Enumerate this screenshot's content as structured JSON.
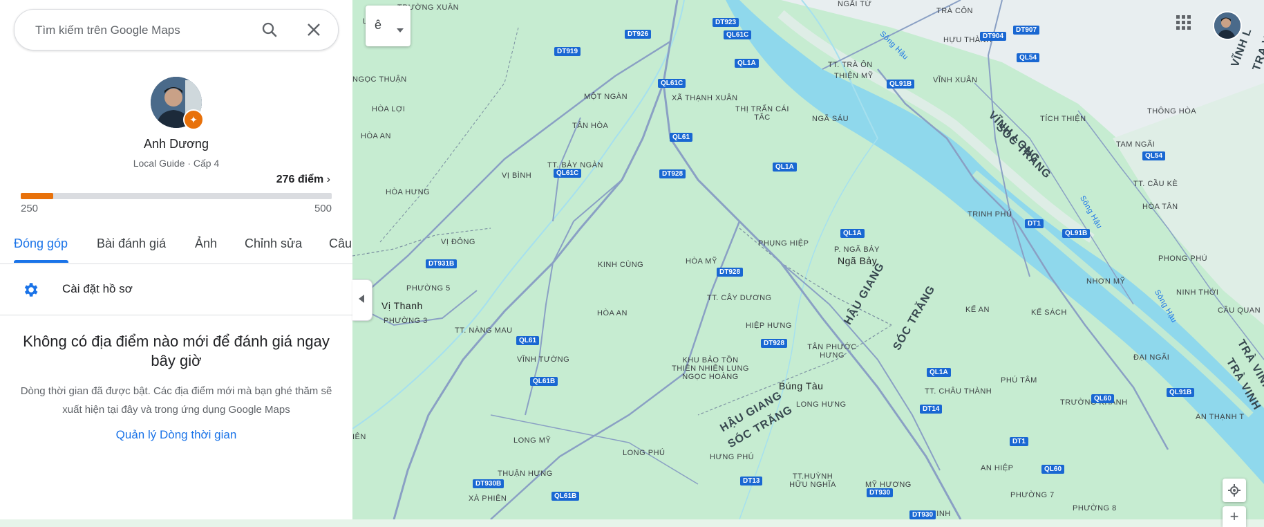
{
  "search": {
    "placeholder": "Tìm kiếm trên Google Maps"
  },
  "profile": {
    "name": "Anh Dương",
    "level": "Local Guide · Cấp 4",
    "points_label": "276 điểm",
    "progress": {
      "min": "250",
      "max": "500",
      "fraction": 0.104
    }
  },
  "tabs": [
    {
      "label": "Đóng góp",
      "active": true
    },
    {
      "label": "Bài đánh giá"
    },
    {
      "label": "Ảnh"
    },
    {
      "label": "Chỉnh sửa"
    },
    {
      "label": "Câu"
    }
  ],
  "settings": {
    "label": "Cài đặt hồ sơ"
  },
  "empty_state": {
    "title": "Không có địa điểm nào mới để đánh giá ngay bây giờ",
    "description": "Dòng thời gian đã được bật. Các địa điểm mới mà bạn ghé thăm sẽ xuất hiện tại đây và trong ứng dụng Google Maps",
    "link": "Quản lý Dòng thời gian"
  },
  "map": {
    "layers_control_label": "ê",
    "place_labels": {
      "truong_xuan": "TRƯỜNG XUÂN",
      "ngai_tu": "NGÃI TỨ",
      "tra_con": "TRÀ CÔN",
      "huu_thanh": "HỰU THÀNH",
      "ngoc_thuan": "NGỌC THUẬN",
      "mot_ngan": "MỘT NGÀN",
      "xa_thanh_xuan": "XÃ THẠNH XUÂN",
      "hoa_loi": "HÒA LỢI",
      "tan_hoa": "TÂN HÒA",
      "thi_tran_cai_tac": "THỊ TRẤN CÁI TẮC",
      "nga_sau": "NGÃ SÁU",
      "tt_tra_on": "TT. TRÀ ÔN",
      "thien_my": "THIỆN MỸ",
      "vinh_xuan": "VĨNH XUÂN",
      "hoa_an_1": "HÒA AN",
      "tich_thien": "TÍCH THIỆN",
      "thong_hoa": "THÔNG HÒA",
      "tam_ngai": "TAM NGÃI",
      "vi_binh": "VỊ BÌNH",
      "tt_bay_ngan": "TT. BẢY NGÀN",
      "hoa_hung": "HÒA HƯNG",
      "tt_cau_ke": "TT. CẦU KÈ",
      "trinh_phu": "TRINH PHÚ",
      "hoa_tan": "HÒA TÂN",
      "vi_dong": "VỊ ĐÔNG",
      "phung_hiep": "PHỤNG HIỆP",
      "p_nga_bay": "P. NGÃ BẢY",
      "nga_bay": "Ngã Bảy",
      "kinh_cung": "KINH CÙNG",
      "hoa_my": "HÒA MỸ",
      "phong_phu": "PHONG PHÚ",
      "phuong_5": "PHƯỜNG 5",
      "vi_thanh": "Vị Thanh",
      "phuong_3": "PHƯỜNG 3",
      "nhon_my": "NHƠN MỸ",
      "ninh_thoi": "NINH THỚI",
      "tt_cay_duong": "TT. CÂY DƯƠNG",
      "hoa_an_2": "HÒA AN",
      "ke_an": "KẾ AN",
      "ke_sach": "KẾ SÁCH",
      "cau_quan": "CẦU QUAN",
      "tt_nang_mau": "TT. NÀNG MAU",
      "hiep_hung": "HIỆP HƯNG",
      "tan_phuoc_hung": "TÂN PHƯỚC HƯNG",
      "vinh_tuong": "VĨNH TƯỜNG",
      "dai_ngai": "ĐẠI NGÃI",
      "khu_bao_ton": "KHU BẢO TỒN THIÊN NHIÊN LUNG NGỌC HOÀNG",
      "bung_tau": "Búng Tàu",
      "phu_tam": "PHÚ TÂM",
      "tt_chau_thanh": "TT. CHÂU THÀNH",
      "long_hung": "LONG HƯNG",
      "truong_khanh": "TRƯỜNG KHÁNH",
      "an_thanh_t": "AN THẠNH T",
      "long_my": "LONG MỸ",
      "long_phu": "LONG PHÚ",
      "hung_phu": "HƯNG PHÚ",
      "thuan_hung": "THUẬN HƯNG",
      "tt_huynh_huu_nghia": "TT.HUỲNH HỮU NGHĨA",
      "my_huong": "MỸ HƯƠNG",
      "an_hiep": "AN HIỆP",
      "phuong_7": "PHƯỜNG 7",
      "xa_phien": "XÀ PHIÊN",
      "an_ninh": "AN NINH",
      "phuong_8": "PHƯỜNG 8"
    },
    "region_labels": {
      "vinh_long": "VĨNH LONG",
      "soc_trang_1": "SÓC TRĂNG",
      "hau_giang_1": "HẬU GIANG",
      "soc_trang_2": "SÓC TRĂNG",
      "hau_giang_2": "HẬU GIANG",
      "soc_trang_3": "SÓC TRĂNG",
      "tra_vinh_1": "TRÀ VINH",
      "tra_vinh_2": "TRÀ VINH",
      "vinh_l": "VĨNH L",
      "tra_vin": "TRA VIN",
      "lo": "LỘ",
      "ien": "IÊN"
    },
    "water_labels": {
      "song_hau_1": "Sông Hậu",
      "song_hau_2": "Sông Hậu",
      "song_hau_3": "Sông Hậu"
    },
    "road_shields": {
      "dt923": "DT923",
      "ql61c_1": "QL61C",
      "dt926": "DT926",
      "dt904": "DT904",
      "dt907": "DT907",
      "dt919": "DT919",
      "ql1a_1": "QL1A",
      "ql54_1": "QL54",
      "ql61c_2": "QL61C",
      "ql91b_1": "QL91B",
      "ql61": "QL61",
      "dt928_1": "DT928",
      "ql1a_2": "QL1A",
      "ql61c_3": "QL61C",
      "ql54_2": "QL54",
      "dt1_1": "DT1",
      "ql91b_2": "QL91B",
      "ql1a_3": "QL1A",
      "dt931b": "DT931B",
      "dt928_2": "DT928",
      "ql61_2": "QL61",
      "dt928_3": "DT928",
      "ql1a_4": "QL1A",
      "ql61b_1": "QL61B",
      "ql60_1": "QL60",
      "ql91b_3": "QL91B",
      "dt14": "DT14",
      "dt1_2": "DT1",
      "ql60_2": "QL60",
      "dt930b": "DT930B",
      "ql61b_2": "QL61B",
      "dt13": "DT13",
      "dt930_1": "DT930",
      "dt930_2": "DT930"
    }
  }
}
